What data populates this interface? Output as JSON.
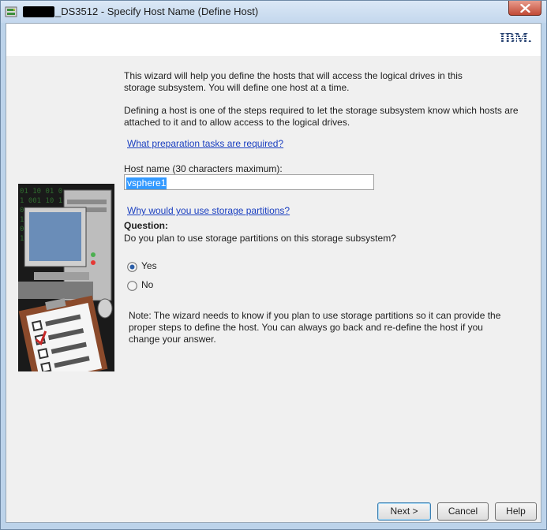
{
  "window": {
    "title": "_DS3512 - Specify Host Name (Define Host)"
  },
  "header": {
    "logo_text": "IBM."
  },
  "intro": {
    "paragraph1": "This wizard will help you define the hosts that will access the logical drives in this storage subsystem.  You will define one host at a time.",
    "paragraph2": "Defining a host is one of the steps required to let the storage subsystem know which hosts are attached to it and to allow access to the logical drives.",
    "prep_link": "What preparation tasks are required?"
  },
  "host": {
    "label": "Host name (30 characters maximum):",
    "value": "vsphere1"
  },
  "partitions": {
    "link": "Why would you use storage partitions?",
    "question_heading": "Question:",
    "question_text": "Do you plan to use storage partitions on this storage subsystem?",
    "options": [
      {
        "label": "Yes",
        "selected": true
      },
      {
        "label": "No",
        "selected": false
      }
    ],
    "note": "Note: The wizard needs to know if you plan to use storage partitions so it can provide the proper steps to define the host.  You can always go back and re-define the host if you change your answer."
  },
  "buttons": {
    "next": "Next >",
    "cancel": "Cancel",
    "help": "Help"
  },
  "icons": [
    "app-icon",
    "close-icon",
    "ibm-logo",
    "computer-checklist-illustration",
    "radio-selected-icon",
    "radio-unselected-icon"
  ]
}
